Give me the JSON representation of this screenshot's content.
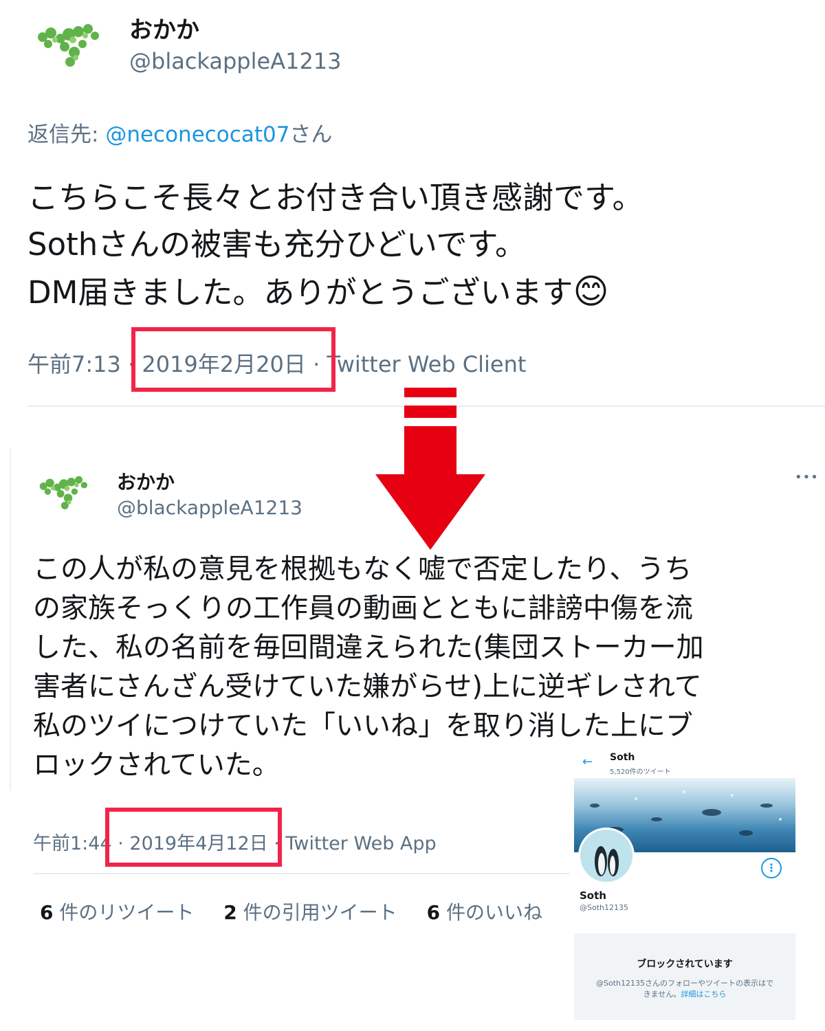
{
  "tweet1": {
    "display_name": "おかか",
    "handle": "@blackappleA1213",
    "reply_prefix": "返信先: ",
    "reply_to": "@neconecocat07",
    "reply_suffix": "さん",
    "text": "こちらこそ長々とお付き合い頂き感謝です。\nSothさんの被害も充分ひどいです。\nDM届きました。ありがとうございます",
    "emoji": "😊",
    "time": "午前7:13",
    "dot": " · ",
    "date": "2019年2月20日",
    "client": "Twitter Web Client"
  },
  "tweet2": {
    "display_name": "おかか",
    "handle": "@blackappleA1213",
    "more": "•••",
    "text": "この人が私の意見を根拠もなく嘘で否定したり、うち\nの家族そっくりの工作員の動画とともに誹謗中傷を流\nした、私の名前を毎回間違えられた(集団ストーカー加\n害者にさんざん受けていた嫌がらせ)上に逆ギレされて\n私のツイにつけていた「いいね」を取り消した上にブ\nロックされていた。",
    "time": "午前1:44",
    "date": "2019年4月12日",
    "client": "Twitter Web App",
    "stats": [
      {
        "count": "6",
        "label": " 件のリツイート"
      },
      {
        "count": "2",
        "label": " 件の引用ツイート"
      },
      {
        "count": "6",
        "label": " 件のいいね"
      }
    ]
  },
  "profile_inset": {
    "back_icon": "←",
    "header_name": "Soth",
    "tweet_count": "5,520件のツイート",
    "name": "Soth",
    "handle": "@Soth12135",
    "more_icon": "⋮",
    "blocked_title": "ブロックされています",
    "blocked_desc_1": "@Soth12135さんのフォローやツイートの表示はで",
    "blocked_desc_2": "きません。",
    "blocked_link": "詳細はこちら"
  },
  "colors": {
    "highlight": "#f2244a",
    "arrow": "#e60012",
    "link": "#1b95e0",
    "muted": "#5b7083"
  }
}
